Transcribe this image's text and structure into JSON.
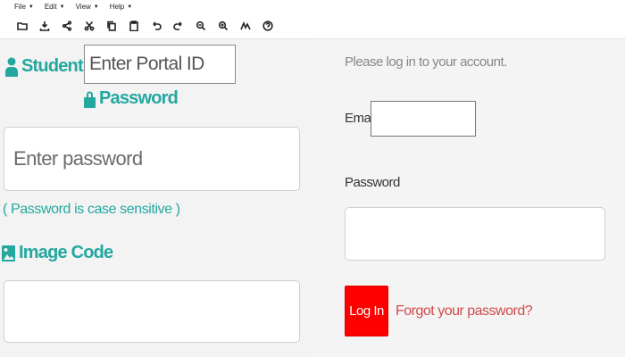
{
  "menubar": {
    "items": [
      {
        "label": "File"
      },
      {
        "label": "Edit"
      },
      {
        "label": "View"
      },
      {
        "label": "Help"
      }
    ]
  },
  "toolbar": {
    "icons": [
      "folder-icon",
      "download-icon",
      "share-icon",
      "cut-icon",
      "copy-icon",
      "paste-icon",
      "undo-icon",
      "redo-icon",
      "zoom-out-icon",
      "zoom-in-icon",
      "draw-icon",
      "help-icon"
    ]
  },
  "left_form": {
    "student_id_label": "Student ID",
    "portal_id_placeholder": "Enter Portal ID",
    "password_label": "Password",
    "password_placeholder": "Enter password",
    "case_note": "( Password is case sensitive )",
    "image_code_label": "Image Code"
  },
  "right_form": {
    "intro": "Please log in to your account.",
    "email_label": "Email",
    "password_label": "Password",
    "login_button": "Log In",
    "forgot_link": "Forgot your password?"
  },
  "colors": {
    "teal_accent": "#23a8a0",
    "login_red": "#ff0000",
    "link_red": "#d14a4a"
  }
}
